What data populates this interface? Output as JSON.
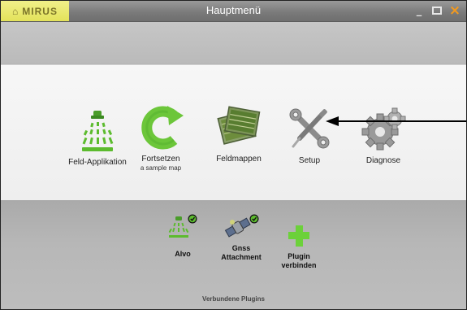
{
  "window": {
    "logo_text": "MIRUS",
    "title": "Hauptmenü",
    "minimize_label": "_",
    "maximize_label": "□",
    "close_label": "×"
  },
  "menu": {
    "items": [
      {
        "label": "Feld-Applikation",
        "icon": "sprayer-icon"
      },
      {
        "label": "Fortsetzen",
        "sublabel": "a sample map",
        "icon": "resume-icon"
      },
      {
        "label": "Feldmappen",
        "icon": "field-maps-icon"
      },
      {
        "label": "Setup",
        "icon": "wrench-screwdriver-icon"
      },
      {
        "label": "Diagnose",
        "icon": "gears-icon"
      }
    ]
  },
  "plugins": {
    "items": [
      {
        "label": "Alvo",
        "icon": "sprayer-icon",
        "connected": true
      },
      {
        "label": "Gnss\nAttachment",
        "line1": "Gnss",
        "line2": "Attachment",
        "icon": "satellite-icon",
        "connected": true
      },
      {
        "label": "Plugin\nverbinden",
        "line1": "Plugin",
        "line2": "verbinden",
        "icon": "plus-icon",
        "connected": false
      }
    ],
    "footer": "Verbundene Plugins"
  },
  "colors": {
    "accent_green": "#5cbb2e",
    "logo_yellow": "#e8e76a",
    "close_orange": "#f39a1e"
  }
}
